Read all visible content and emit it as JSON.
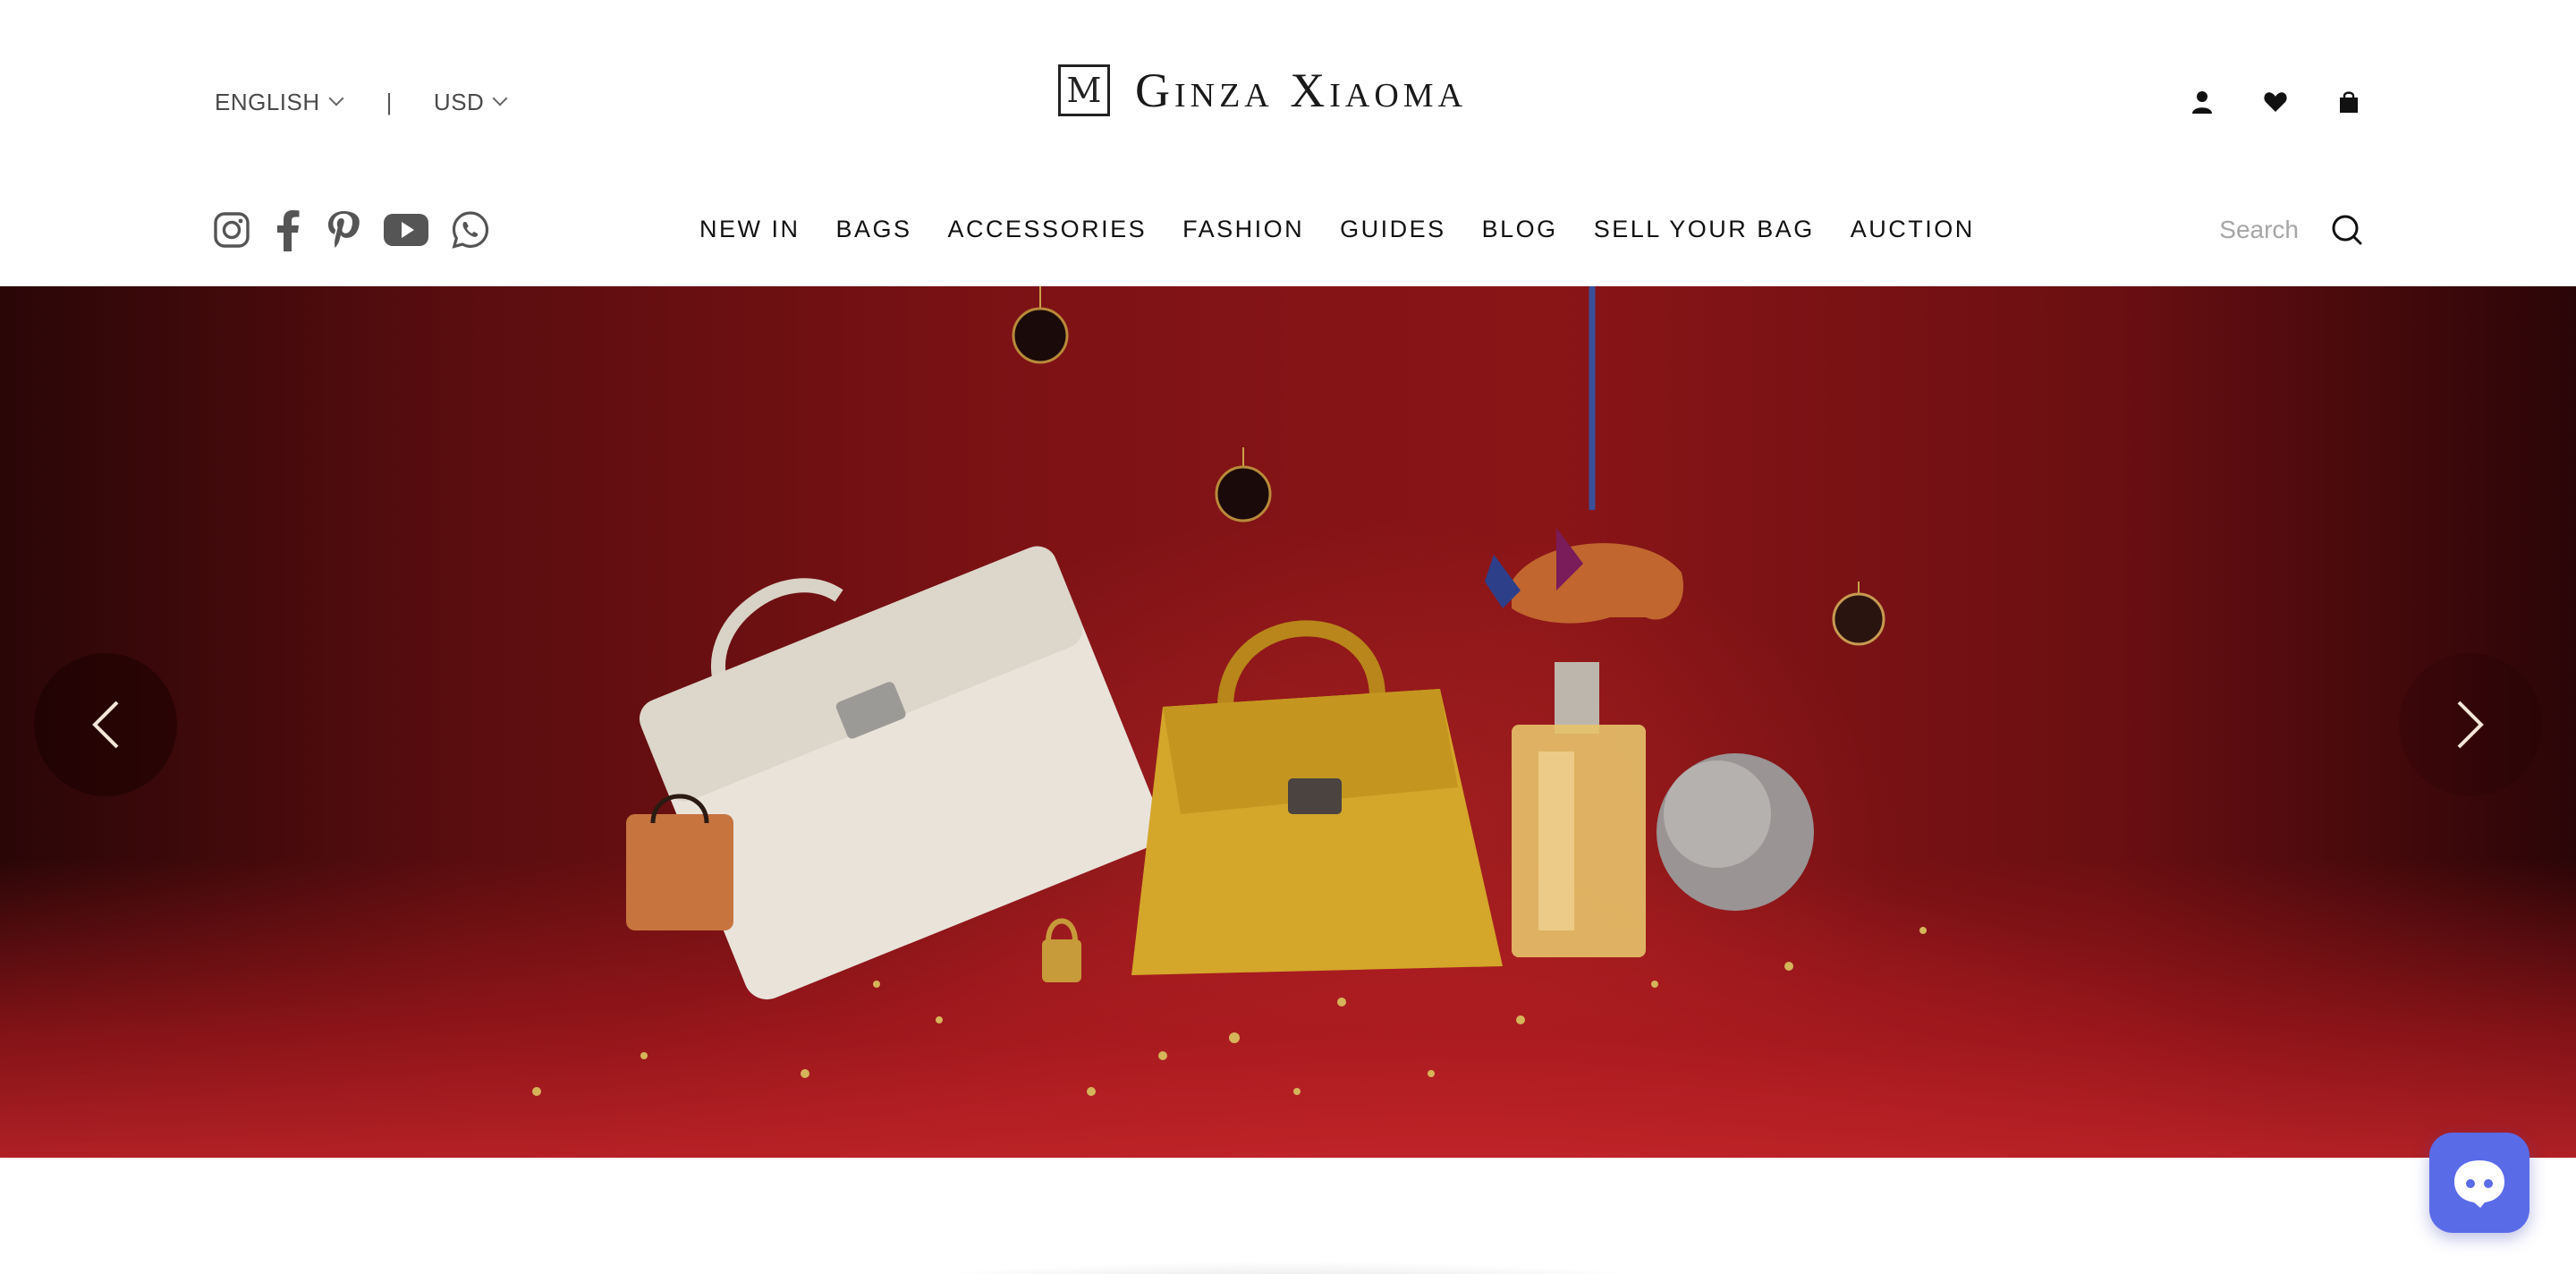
{
  "header": {
    "language": "ENGLISH",
    "currency": "USD",
    "separator": "|",
    "brand_name": "Ginza Xiaoma",
    "brand_mark": "M",
    "user_icons": [
      "account-icon",
      "wishlist-heart-icon",
      "shopping-bag-icon"
    ]
  },
  "social": [
    "instagram-icon",
    "facebook-icon",
    "pinterest-icon",
    "youtube-icon",
    "whatsapp-icon"
  ],
  "nav": {
    "items": [
      "NEW IN",
      "BAGS",
      "ACCESSORIES",
      "FASHION",
      "GUIDES",
      "BLOG",
      "SELL YOUR BAG",
      "AUCTION"
    ]
  },
  "search": {
    "placeholder": "Search"
  },
  "hero": {
    "controls": [
      "prev-arrow-icon",
      "next-arrow-icon"
    ]
  },
  "colors": {
    "hero_red": "#7d1215",
    "chat_button": "#5a6be8",
    "text": "#111111"
  }
}
